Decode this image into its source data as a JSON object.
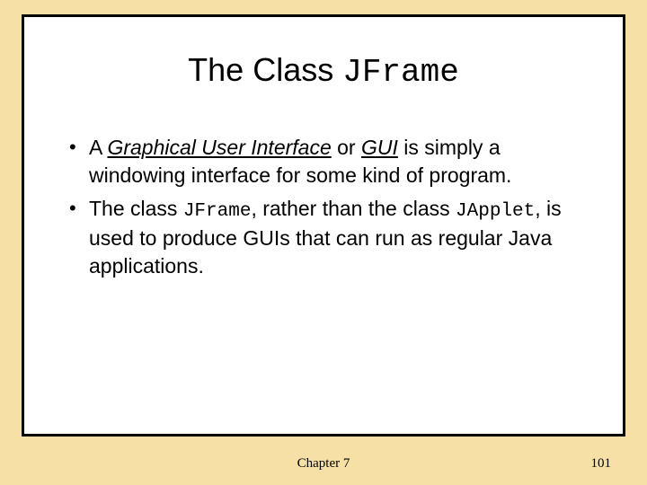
{
  "title": {
    "prefix": "The Class ",
    "code": "JFrame"
  },
  "bullets": {
    "b1": {
      "pre": "A ",
      "gui_term": "Graphical User Interface",
      "mid": " or ",
      "gui_abbr": "GUI",
      "post": " is simply a windowing interface for some kind of program."
    },
    "b2": {
      "pre": "The class ",
      "code1": "JFrame",
      "mid1": ", rather than the class ",
      "code2": "JApplet",
      "post": ", is used to produce GUIs that can run as regular Java applications."
    }
  },
  "footer": {
    "chapter": "Chapter 7",
    "page": "101"
  }
}
